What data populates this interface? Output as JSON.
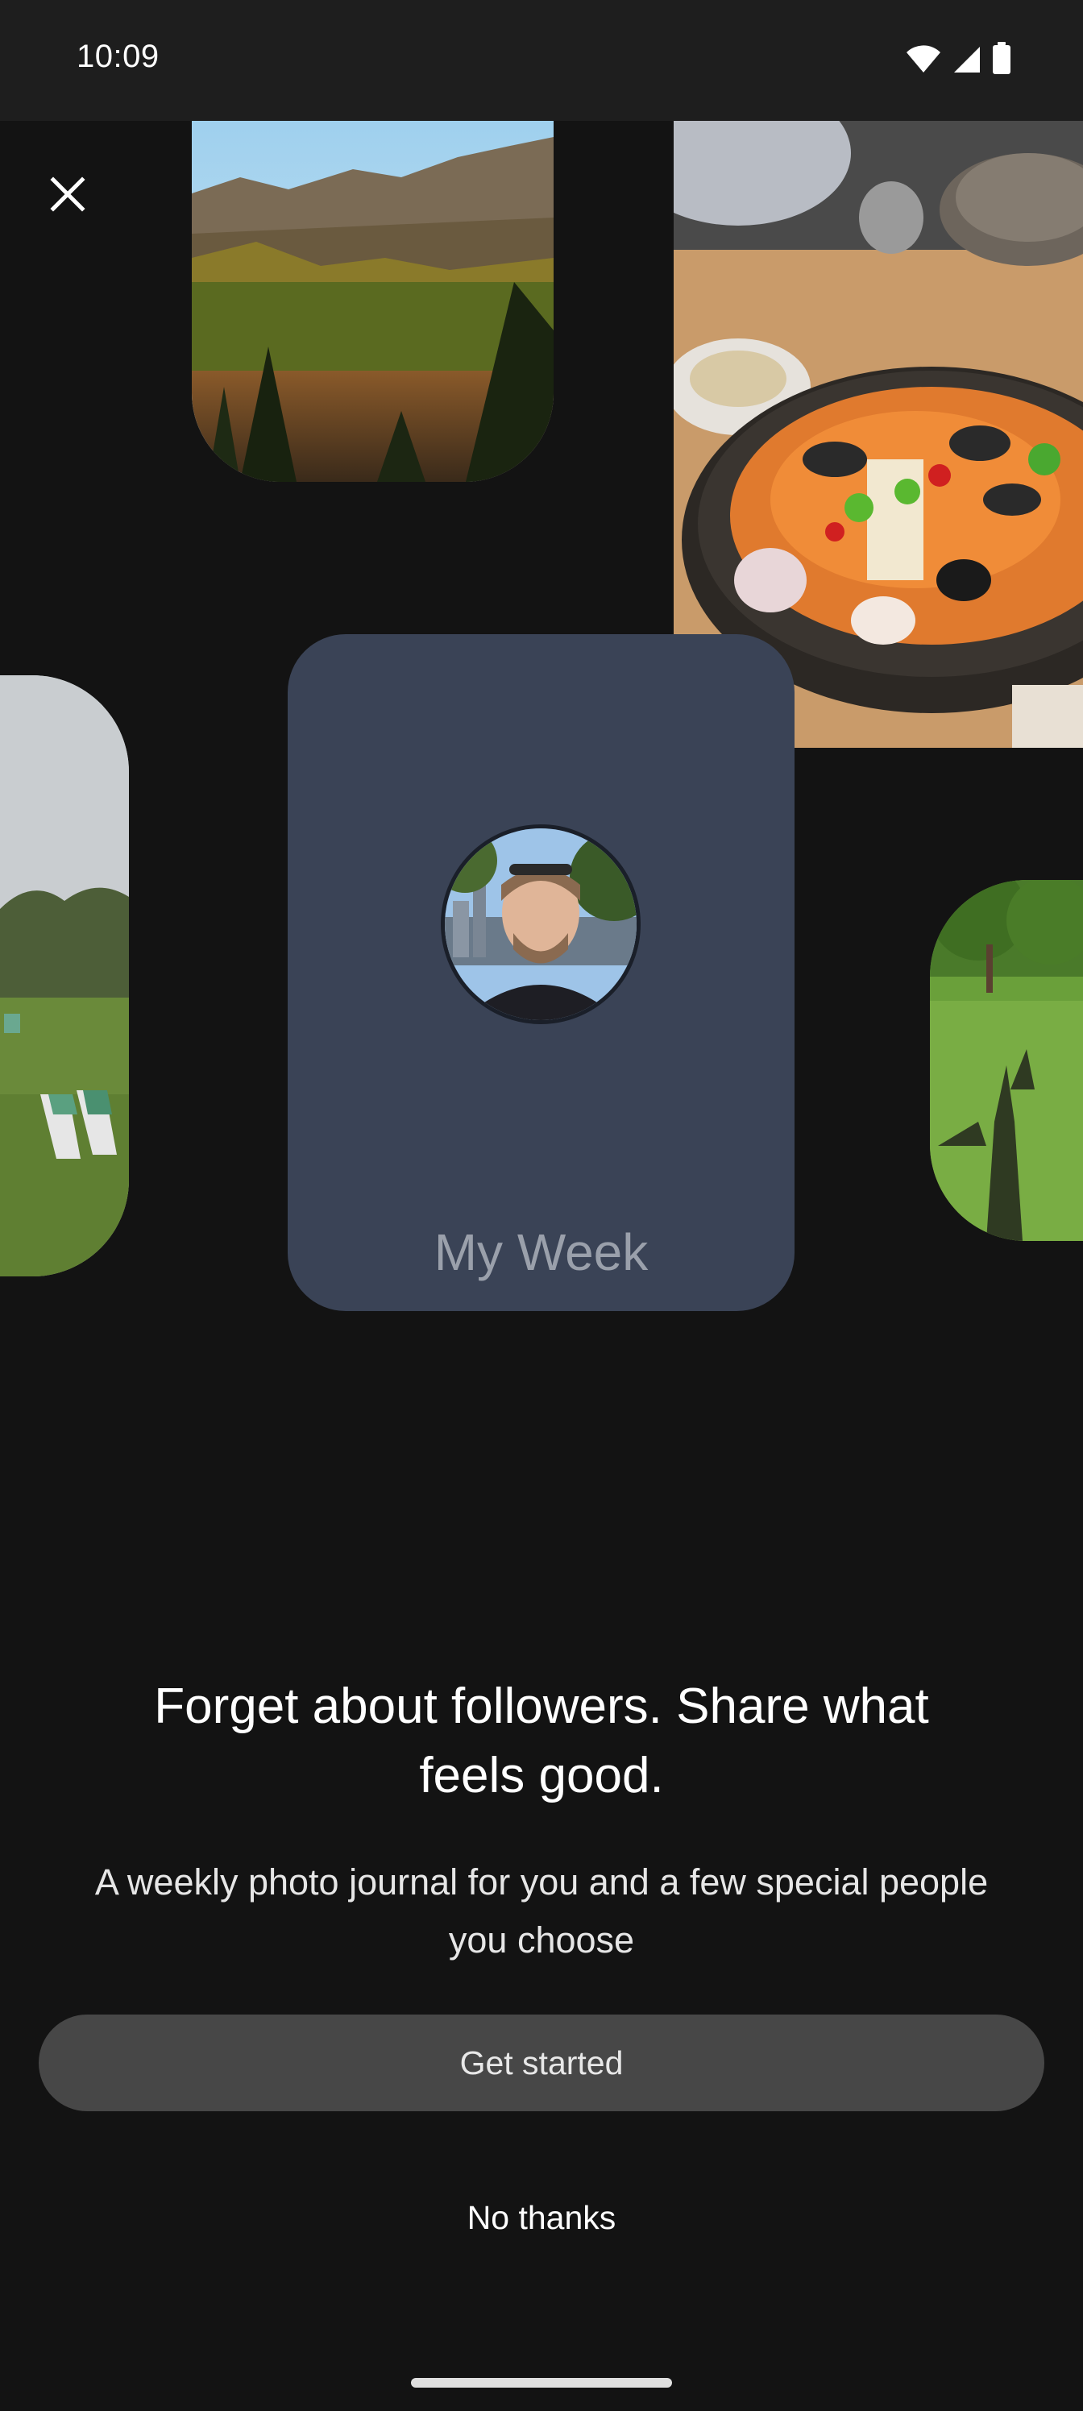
{
  "status_bar": {
    "time": "10:09",
    "icons": [
      "wifi-icon",
      "signal-icon",
      "battery-icon"
    ]
  },
  "close_icon": "close-icon",
  "photos": [
    {
      "name": "photo-lake",
      "subject": "mountain lake with trees"
    },
    {
      "name": "photo-food",
      "subject": "seafood stew in stone bowl"
    },
    {
      "name": "photo-park",
      "subject": "park with deck chairs"
    },
    {
      "name": "photo-shadow",
      "subject": "shadows on grass"
    }
  ],
  "card": {
    "title": "My Week",
    "avatar": "profile photo"
  },
  "headline": "Forget about followers. Share what feels good.",
  "subtitle": "A weekly photo journal for you and a few special people you choose",
  "buttons": {
    "get_started": "Get started",
    "no_thanks": "No thanks"
  },
  "colors": {
    "background": "#131313",
    "status_bar": "#1e1e1e",
    "card": "#3a4356",
    "primary_button": "#474747"
  }
}
